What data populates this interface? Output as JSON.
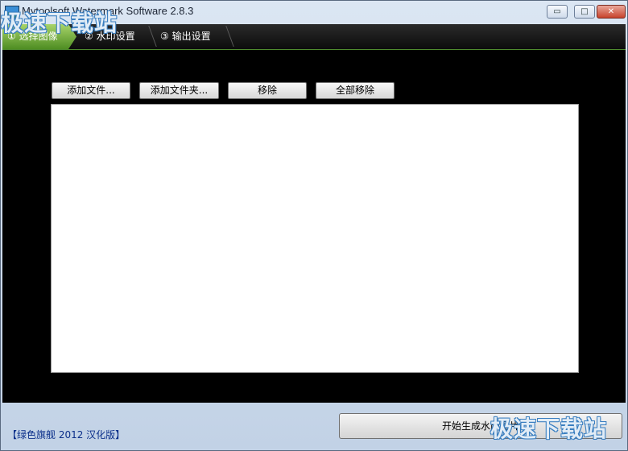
{
  "window": {
    "title": "Mytoolsoft Watermark Software 2.8.3",
    "minimize_label": "▭",
    "maximize_label": "□",
    "close_label": "✕"
  },
  "steps": [
    {
      "label": "① 选择图像",
      "active": true
    },
    {
      "label": "② 水印设置",
      "active": false
    },
    {
      "label": "③ 输出设置",
      "active": false
    }
  ],
  "toolbar": {
    "add_files": "添加文件...",
    "add_folder": "添加文件夹...",
    "remove": "移除",
    "remove_all": "全部移除"
  },
  "footer": {
    "edition": "【绿色旗舰 2012 汉化版】",
    "start_button": "开始生成水印图片"
  },
  "watermark": {
    "text": "极速下载站"
  },
  "colors": {
    "active_step": "#6fae37",
    "main_background": "#000000",
    "list_background": "#ffffff",
    "link": "#0b2f8a"
  }
}
